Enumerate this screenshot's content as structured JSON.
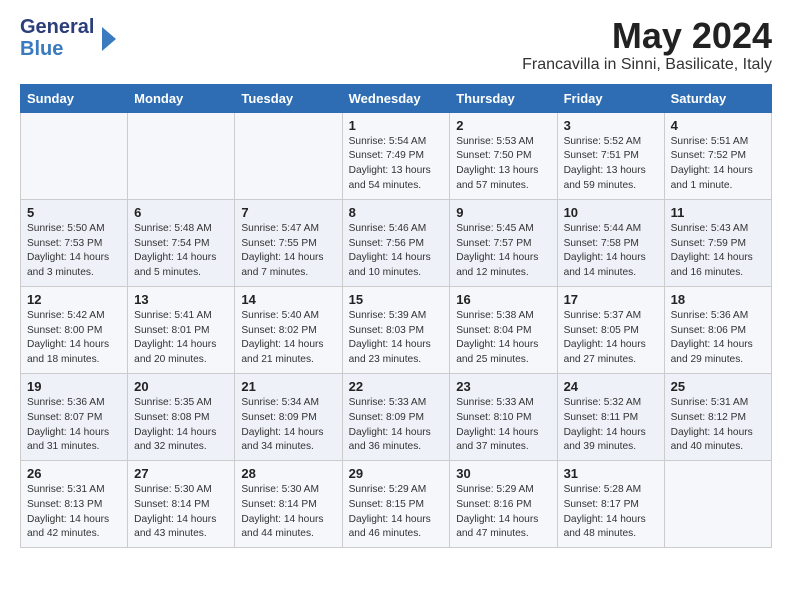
{
  "logo": {
    "general": "General",
    "blue": "Blue"
  },
  "header": {
    "month": "May 2024",
    "location": "Francavilla in Sinni, Basilicate, Italy"
  },
  "weekdays": [
    "Sunday",
    "Monday",
    "Tuesday",
    "Wednesday",
    "Thursday",
    "Friday",
    "Saturday"
  ],
  "weeks": [
    [
      {
        "day": "",
        "info": ""
      },
      {
        "day": "",
        "info": ""
      },
      {
        "day": "",
        "info": ""
      },
      {
        "day": "1",
        "info": "Sunrise: 5:54 AM\nSunset: 7:49 PM\nDaylight: 13 hours\nand 54 minutes."
      },
      {
        "day": "2",
        "info": "Sunrise: 5:53 AM\nSunset: 7:50 PM\nDaylight: 13 hours\nand 57 minutes."
      },
      {
        "day": "3",
        "info": "Sunrise: 5:52 AM\nSunset: 7:51 PM\nDaylight: 13 hours\nand 59 minutes."
      },
      {
        "day": "4",
        "info": "Sunrise: 5:51 AM\nSunset: 7:52 PM\nDaylight: 14 hours\nand 1 minute."
      }
    ],
    [
      {
        "day": "5",
        "info": "Sunrise: 5:50 AM\nSunset: 7:53 PM\nDaylight: 14 hours\nand 3 minutes."
      },
      {
        "day": "6",
        "info": "Sunrise: 5:48 AM\nSunset: 7:54 PM\nDaylight: 14 hours\nand 5 minutes."
      },
      {
        "day": "7",
        "info": "Sunrise: 5:47 AM\nSunset: 7:55 PM\nDaylight: 14 hours\nand 7 minutes."
      },
      {
        "day": "8",
        "info": "Sunrise: 5:46 AM\nSunset: 7:56 PM\nDaylight: 14 hours\nand 10 minutes."
      },
      {
        "day": "9",
        "info": "Sunrise: 5:45 AM\nSunset: 7:57 PM\nDaylight: 14 hours\nand 12 minutes."
      },
      {
        "day": "10",
        "info": "Sunrise: 5:44 AM\nSunset: 7:58 PM\nDaylight: 14 hours\nand 14 minutes."
      },
      {
        "day": "11",
        "info": "Sunrise: 5:43 AM\nSunset: 7:59 PM\nDaylight: 14 hours\nand 16 minutes."
      }
    ],
    [
      {
        "day": "12",
        "info": "Sunrise: 5:42 AM\nSunset: 8:00 PM\nDaylight: 14 hours\nand 18 minutes."
      },
      {
        "day": "13",
        "info": "Sunrise: 5:41 AM\nSunset: 8:01 PM\nDaylight: 14 hours\nand 20 minutes."
      },
      {
        "day": "14",
        "info": "Sunrise: 5:40 AM\nSunset: 8:02 PM\nDaylight: 14 hours\nand 21 minutes."
      },
      {
        "day": "15",
        "info": "Sunrise: 5:39 AM\nSunset: 8:03 PM\nDaylight: 14 hours\nand 23 minutes."
      },
      {
        "day": "16",
        "info": "Sunrise: 5:38 AM\nSunset: 8:04 PM\nDaylight: 14 hours\nand 25 minutes."
      },
      {
        "day": "17",
        "info": "Sunrise: 5:37 AM\nSunset: 8:05 PM\nDaylight: 14 hours\nand 27 minutes."
      },
      {
        "day": "18",
        "info": "Sunrise: 5:36 AM\nSunset: 8:06 PM\nDaylight: 14 hours\nand 29 minutes."
      }
    ],
    [
      {
        "day": "19",
        "info": "Sunrise: 5:36 AM\nSunset: 8:07 PM\nDaylight: 14 hours\nand 31 minutes."
      },
      {
        "day": "20",
        "info": "Sunrise: 5:35 AM\nSunset: 8:08 PM\nDaylight: 14 hours\nand 32 minutes."
      },
      {
        "day": "21",
        "info": "Sunrise: 5:34 AM\nSunset: 8:09 PM\nDaylight: 14 hours\nand 34 minutes."
      },
      {
        "day": "22",
        "info": "Sunrise: 5:33 AM\nSunset: 8:09 PM\nDaylight: 14 hours\nand 36 minutes."
      },
      {
        "day": "23",
        "info": "Sunrise: 5:33 AM\nSunset: 8:10 PM\nDaylight: 14 hours\nand 37 minutes."
      },
      {
        "day": "24",
        "info": "Sunrise: 5:32 AM\nSunset: 8:11 PM\nDaylight: 14 hours\nand 39 minutes."
      },
      {
        "day": "25",
        "info": "Sunrise: 5:31 AM\nSunset: 8:12 PM\nDaylight: 14 hours\nand 40 minutes."
      }
    ],
    [
      {
        "day": "26",
        "info": "Sunrise: 5:31 AM\nSunset: 8:13 PM\nDaylight: 14 hours\nand 42 minutes."
      },
      {
        "day": "27",
        "info": "Sunrise: 5:30 AM\nSunset: 8:14 PM\nDaylight: 14 hours\nand 43 minutes."
      },
      {
        "day": "28",
        "info": "Sunrise: 5:30 AM\nSunset: 8:14 PM\nDaylight: 14 hours\nand 44 minutes."
      },
      {
        "day": "29",
        "info": "Sunrise: 5:29 AM\nSunset: 8:15 PM\nDaylight: 14 hours\nand 46 minutes."
      },
      {
        "day": "30",
        "info": "Sunrise: 5:29 AM\nSunset: 8:16 PM\nDaylight: 14 hours\nand 47 minutes."
      },
      {
        "day": "31",
        "info": "Sunrise: 5:28 AM\nSunset: 8:17 PM\nDaylight: 14 hours\nand 48 minutes."
      },
      {
        "day": "",
        "info": ""
      }
    ]
  ]
}
